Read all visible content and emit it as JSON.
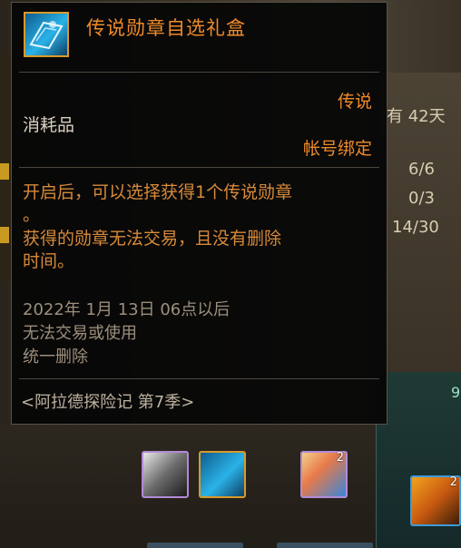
{
  "background": {
    "duration_label": "有 42天",
    "progress_rows": [
      "6/6",
      "0/3",
      "14/30"
    ],
    "teal_panel_text": "9",
    "slots": [
      {
        "icon": "weapon-item-icon",
        "count": ""
      },
      {
        "icon": "legend-medal-box-icon",
        "count": ""
      },
      {
        "icon": "feather-item-icon",
        "count": "2"
      },
      {
        "icon": "gold-box-item-icon",
        "count": "2"
      }
    ]
  },
  "tooltip": {
    "icon": "legend-medal-box-icon",
    "title": "传说勋章自选礼盒",
    "rarity": "传说",
    "category": "消耗品",
    "binding": "帐号绑定",
    "description": [
      "开启后，可以选择获得1个传说勋章",
      "。",
      "获得的勋章无法交易，且没有删除",
      "时间。"
    ],
    "expiry": [
      "2022年 1月 13日 06点以后",
      "无法交易或使用",
      "统一删除"
    ],
    "source": "<阿拉德探险记 第7季>"
  },
  "colors": {
    "title": "#f08a2a",
    "description": "#d78a3a",
    "expiry": "#9c8f7c",
    "icon_border": "#d89a2a"
  }
}
